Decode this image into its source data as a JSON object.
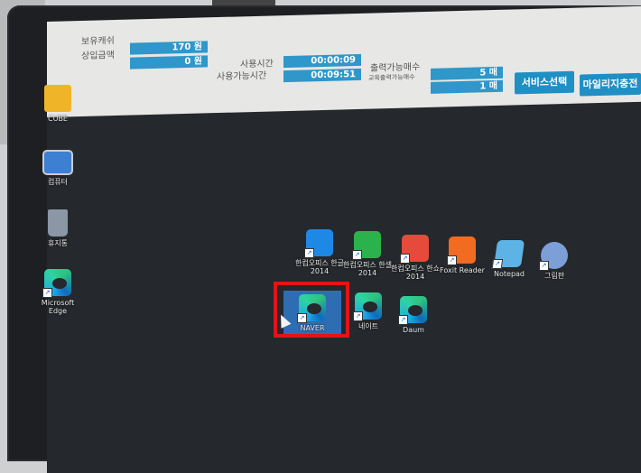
{
  "topbar": {
    "label_left_1": "보유캐쉬",
    "label_left_2": "상입금액",
    "value_left_1": "170 원",
    "value_left_2": "0 원",
    "label_mid_1": "사용시간",
    "label_mid_2": "사용가능시간",
    "value_mid_1": "00:00:09",
    "value_mid_2": "00:09:51",
    "label_right_1": "출력가능매수",
    "label_right_2": "교육출력가능매수",
    "value_right_1": "5 매",
    "value_right_2": "1 매",
    "button_service": "서비스선택",
    "button_mileage": "마일리지충전"
  },
  "desktop": {
    "left_icons": [
      {
        "label": "CUBE"
      },
      {
        "label": "컴퓨터"
      },
      {
        "label": "휴지통"
      },
      {
        "label": "Microsoft Edge"
      }
    ],
    "center_icons": [
      {
        "label": "한컴오피스 한글 2014",
        "color": "#1e88e5"
      },
      {
        "label": "한컴오피스 한셀 2014",
        "color": "#2bb24c"
      },
      {
        "label": "한컴오피스 한쇼 2014",
        "color": "#e64a3b"
      },
      {
        "label": "Foxit Reader",
        "color": "#f26b21"
      },
      {
        "label": "Notepad",
        "color": "#5db3e6"
      },
      {
        "label": "그림판",
        "color": "#7b9fd6"
      }
    ],
    "edge_icons": [
      {
        "label": "NAVER"
      },
      {
        "label": "네이트"
      },
      {
        "label": "Daum"
      }
    ]
  },
  "colors": {
    "highlight": "#e2131b",
    "info_value_bg": "#2f97c9",
    "desktop_bg": "#25282c"
  }
}
